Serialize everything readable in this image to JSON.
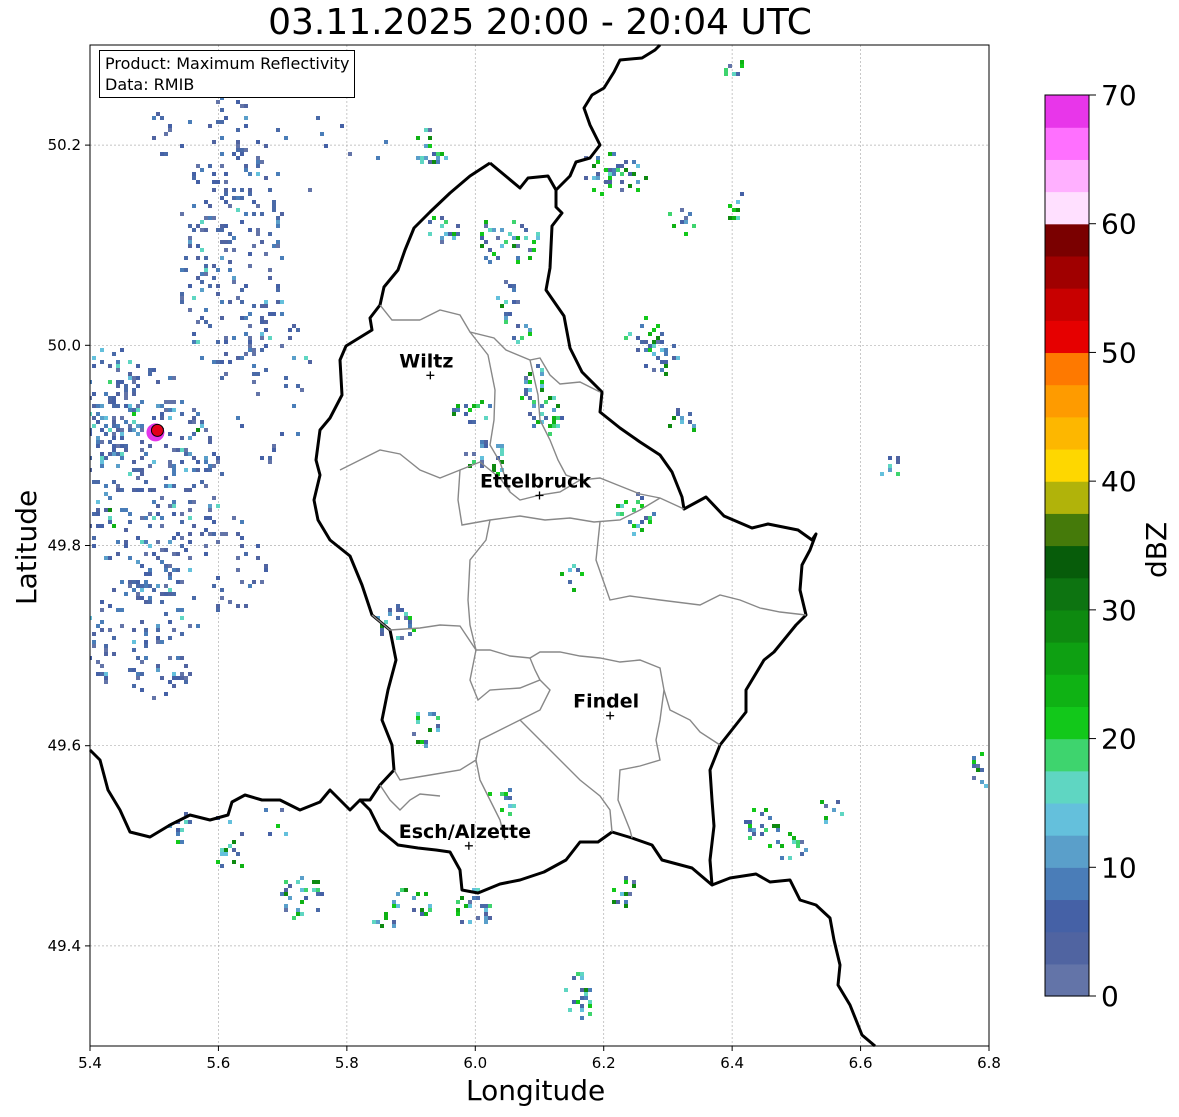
{
  "title": "03.11.2025 20:00 - 20:04 UTC",
  "info_box": {
    "line1": "Product: Maximum Reflectivity",
    "line2": "Data: RMIB"
  },
  "axes": {
    "xlabel": "Longitude",
    "ylabel": "Latitude",
    "xlim": [
      5.4,
      6.8
    ],
    "ylim": [
      49.3,
      50.3
    ],
    "xticks": [
      "5.4",
      "5.6",
      "5.8",
      "6.0",
      "6.2",
      "6.4",
      "6.6",
      "6.8"
    ],
    "yticks": [
      "49.4",
      "49.6",
      "49.8",
      "50.0",
      "50.2"
    ],
    "grid": true
  },
  "colorbar": {
    "label": "dBZ",
    "ticks": [
      "0",
      "10",
      "20",
      "30",
      "40",
      "50",
      "60",
      "70"
    ],
    "range": [
      0,
      70
    ],
    "colors": [
      "#6374a8",
      "#5064a1",
      "#4561a6",
      "#4a7db8",
      "#5a9fca",
      "#64c0dc",
      "#5fd6c2",
      "#3ed46e",
      "#12c81a",
      "#0fb214",
      "#0ea012",
      "#0e8a10",
      "#0d7411",
      "#075c0a",
      "#457a0a",
      "#b1b30a",
      "#fed700",
      "#fdb700",
      "#fe9b00",
      "#fe7900",
      "#e60000",
      "#c80000",
      "#a00000",
      "#7a0000",
      "#ffe0ff",
      "#ffb0ff",
      "#ff70ff",
      "#e836ea"
    ]
  },
  "cities": [
    {
      "name": "Wiltz",
      "lon": 5.93,
      "lat": 49.97
    },
    {
      "name": "Ettelbruck",
      "lon": 6.1,
      "lat": 49.85
    },
    {
      "name": "Findel",
      "lon": 6.21,
      "lat": 49.63
    },
    {
      "name": "Esch/Alzette",
      "lon": 5.99,
      "lat": 49.5
    }
  ],
  "radar_site": {
    "lon": 5.505,
    "lat": 49.915,
    "color": "#e3001b"
  }
}
